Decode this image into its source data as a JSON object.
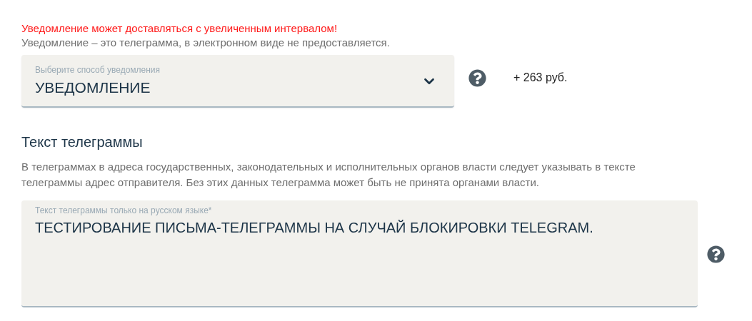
{
  "warning": "Уведомление может доставляться с увеличенным интервалом!",
  "note": "Уведомление – это телеграмма, в электронном виде не предоставляется.",
  "notification_select": {
    "label": "Выберите способ уведомления",
    "value": "УВЕДОМЛЕНИЕ",
    "price": "+ 263 руб."
  },
  "telegram": {
    "heading": "Текст телеграммы",
    "description": "В телеграммах в адреса государственных, законодательных и исполнительных органов власти следует указывать в тексте телеграммы адрес отправителя. Без этих данных телеграмма может быть не принята органами власти.",
    "field": {
      "label": "Текст телеграммы только на русском языке*",
      "value": "ТЕСТИРОВАНИЕ ПИСЬМА-ТЕЛЕГРАММЫ НА СЛУЧАЙ БЛОКИРОВКИ TELEGRAM."
    }
  }
}
